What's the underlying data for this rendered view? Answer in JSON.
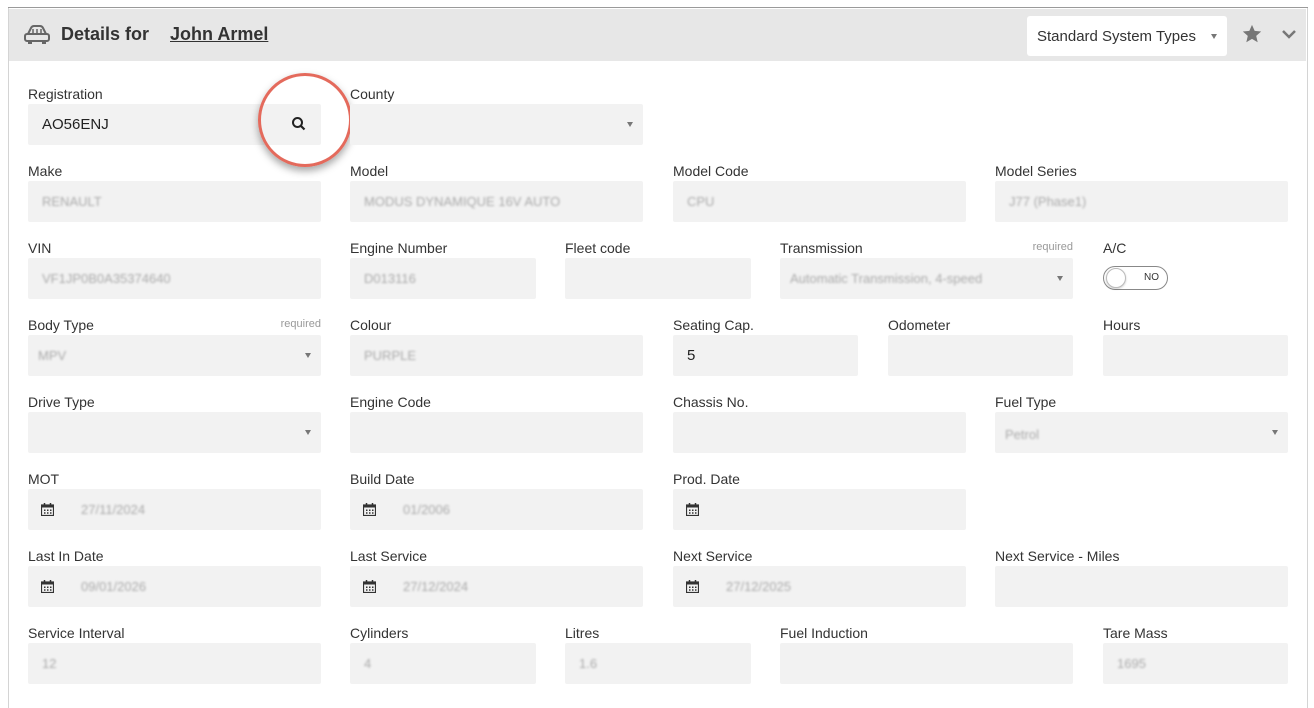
{
  "header": {
    "title_prefix": "Details for",
    "customer_name": "John Armel",
    "type_select": "Standard System Types",
    "icons": [
      "car-icon",
      "star-icon",
      "chevron-down-icon"
    ]
  },
  "labels": {
    "registration": "Registration",
    "county": "County",
    "make": "Make",
    "model": "Model",
    "model_code": "Model Code",
    "model_series": "Model Series",
    "vin": "VIN",
    "engine_number": "Engine Number",
    "fleet_code": "Fleet code",
    "transmission": "Transmission",
    "ac": "A/C",
    "body_type": "Body Type",
    "colour": "Colour",
    "seating_cap": "Seating Cap.",
    "odometer": "Odometer",
    "hours": "Hours",
    "drive_type": "Drive Type",
    "engine_code": "Engine Code",
    "chassis_no": "Chassis No.",
    "fuel_type": "Fuel Type",
    "mot": "MOT",
    "build_date": "Build Date",
    "prod_date": "Prod. Date",
    "last_in_date": "Last In Date",
    "last_service": "Last Service",
    "next_service": "Next Service",
    "next_service_miles": "Next Service - Miles",
    "service_interval": "Service Interval",
    "cylinders": "Cylinders",
    "litres": "Litres",
    "fuel_induction": "Fuel Induction",
    "tare_mass": "Tare Mass",
    "required": "required"
  },
  "values": {
    "registration": "AO56ENJ",
    "make": "RENAULT",
    "model": "MODUS DYNAMIQUE 16V AUTO",
    "model_code": "CPU",
    "model_series": "J77 (Phase1)",
    "vin": "VF1JP0B0A35374640",
    "engine_number": "D013116",
    "transmission": "Automatic Transmission, 4-speed",
    "ac": "NO",
    "body_type": "MPV",
    "colour": "PURPLE",
    "seating_cap": "5",
    "fuel_type": "Petrol",
    "mot": "27/11/2024",
    "build_date": "01/2006",
    "last_in_date": "09/01/2026",
    "last_service": "27/12/2024",
    "next_service": "27/12/2025",
    "service_interval": "12",
    "cylinders": "4",
    "litres": "1.6",
    "tare_mass": "1695"
  },
  "colors": {
    "header_bg": "#e7e7e7",
    "field_bg": "#f2f2f2",
    "highlight_circle": "#e46a5c"
  }
}
